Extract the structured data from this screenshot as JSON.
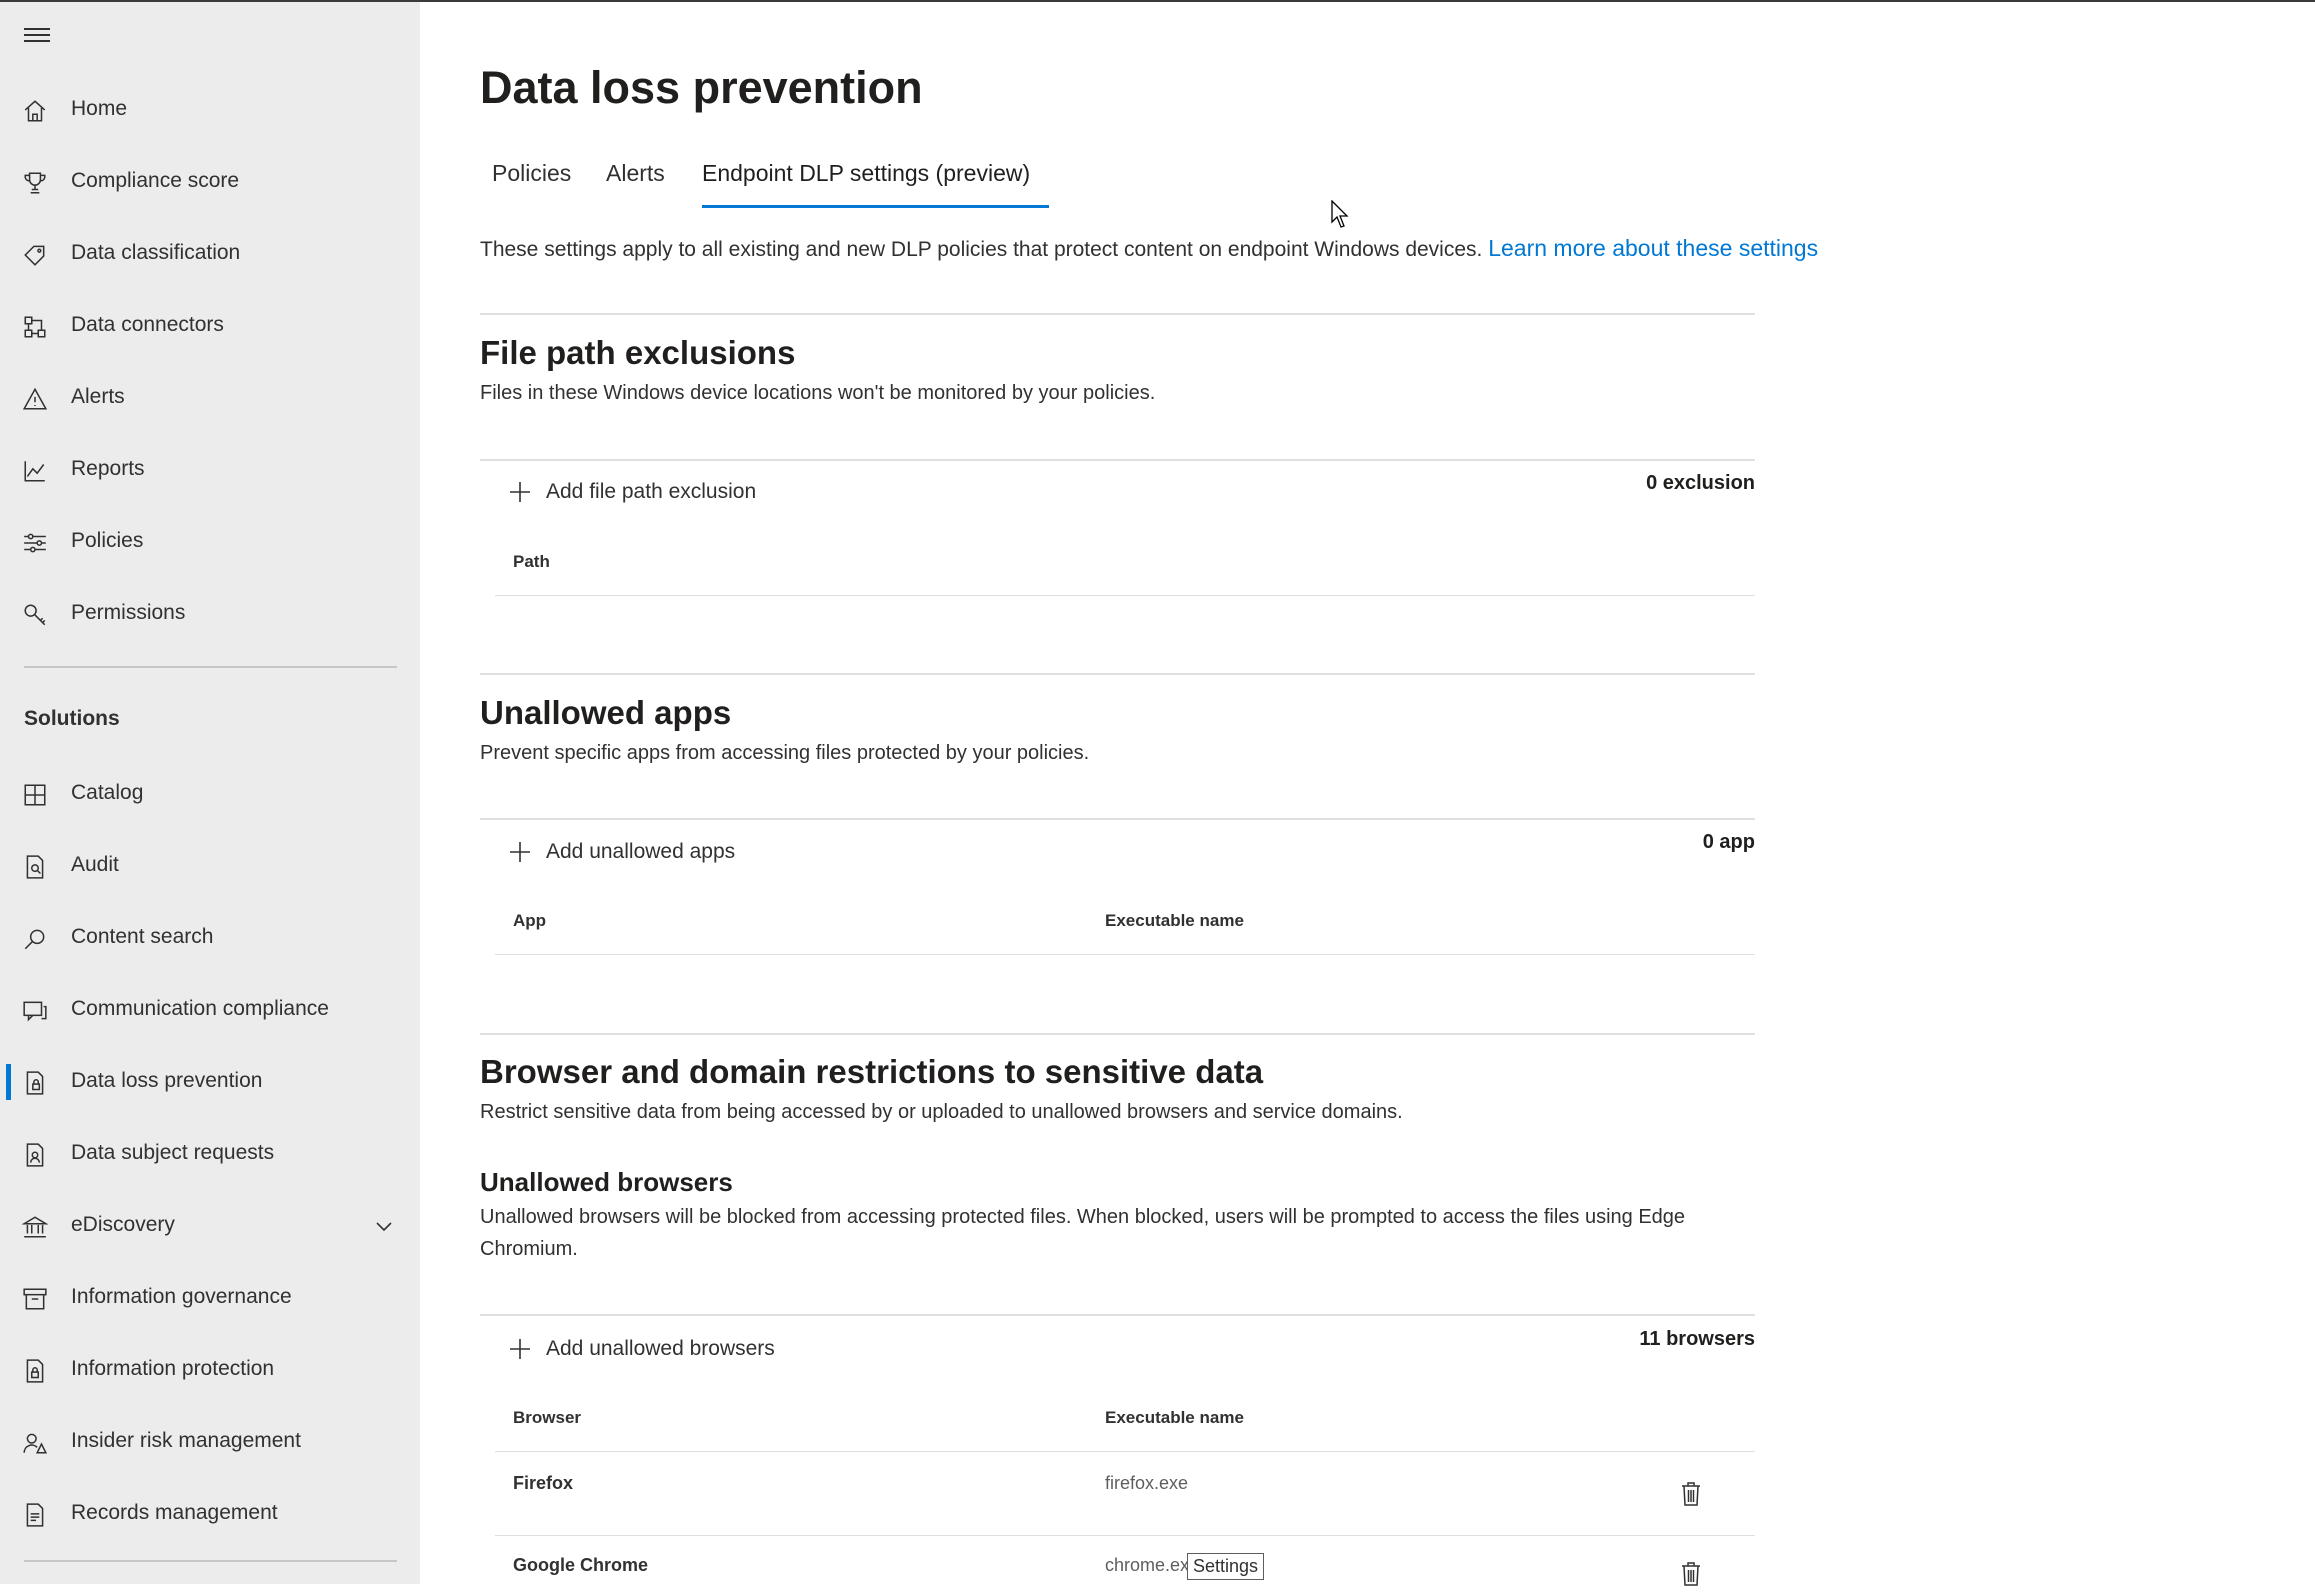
{
  "nav": {
    "items": [
      {
        "label": "Home",
        "icon": "home-icon"
      },
      {
        "label": "Compliance score",
        "icon": "trophy-icon"
      },
      {
        "label": "Data classification",
        "icon": "tag-icon"
      },
      {
        "label": "Data connectors",
        "icon": "connector-icon"
      },
      {
        "label": "Alerts",
        "icon": "warning-icon"
      },
      {
        "label": "Reports",
        "icon": "chart-icon"
      },
      {
        "label": "Policies",
        "icon": "sliders-icon"
      },
      {
        "label": "Permissions",
        "icon": "key-icon"
      }
    ],
    "solutions_title": "Solutions",
    "solutions": [
      {
        "label": "Catalog",
        "icon": "catalog-icon"
      },
      {
        "label": "Audit",
        "icon": "audit-icon"
      },
      {
        "label": "Content search",
        "icon": "search-icon"
      },
      {
        "label": "Communication compliance",
        "icon": "chat-icon"
      },
      {
        "label": "Data loss prevention",
        "icon": "shield-doc-icon",
        "active": true
      },
      {
        "label": "Data subject requests",
        "icon": "person-doc-icon"
      },
      {
        "label": "eDiscovery",
        "icon": "bank-icon"
      },
      {
        "label": "Information governance",
        "icon": "archive-icon"
      },
      {
        "label": "Information protection",
        "icon": "lock-doc-icon"
      },
      {
        "label": "Insider risk management",
        "icon": "person-risk-icon"
      },
      {
        "label": "Records management",
        "icon": "records-icon"
      }
    ]
  },
  "page": {
    "title": "Data loss prevention",
    "tabs": [
      "Policies",
      "Alerts",
      "Endpoint DLP settings (preview)"
    ],
    "intro": "These settings apply to all existing and new DLP policies that protect content on endpoint Windows devices.",
    "learn_more": "Learn more about these settings"
  },
  "file_path": {
    "title": "File path exclusions",
    "desc": "Files in these Windows device locations won't be monitored by your policies.",
    "add": "Add file path exclusion",
    "count": "0 exclusion",
    "col_path": "Path"
  },
  "apps": {
    "title": "Unallowed apps",
    "desc": "Prevent specific apps from accessing files protected by your policies.",
    "add": "Add unallowed apps",
    "count": "0 app",
    "col_app": "App",
    "col_exe": "Executable name"
  },
  "browsers": {
    "title": "Browser and domain restrictions to sensitive data",
    "desc": "Restrict sensitive data from being accessed by or uploaded to unallowed browsers and service domains.",
    "sub_title": "Unallowed browsers",
    "sub_desc": "Unallowed browsers will be blocked from accessing protected files. When blocked, users will be prompted to access the files using Edge Chromium.",
    "add": "Add unallowed browsers",
    "count": "11 browsers",
    "col_browser": "Browser",
    "col_exe": "Executable name",
    "rows": [
      {
        "name": "Firefox",
        "exe": "firefox.exe"
      },
      {
        "name": "Google Chrome",
        "exe": "chrome.ex"
      }
    ]
  },
  "tooltip": "Settings",
  "colors": {
    "accent": "#0078d4",
    "sidebar_bg": "#ececec"
  }
}
